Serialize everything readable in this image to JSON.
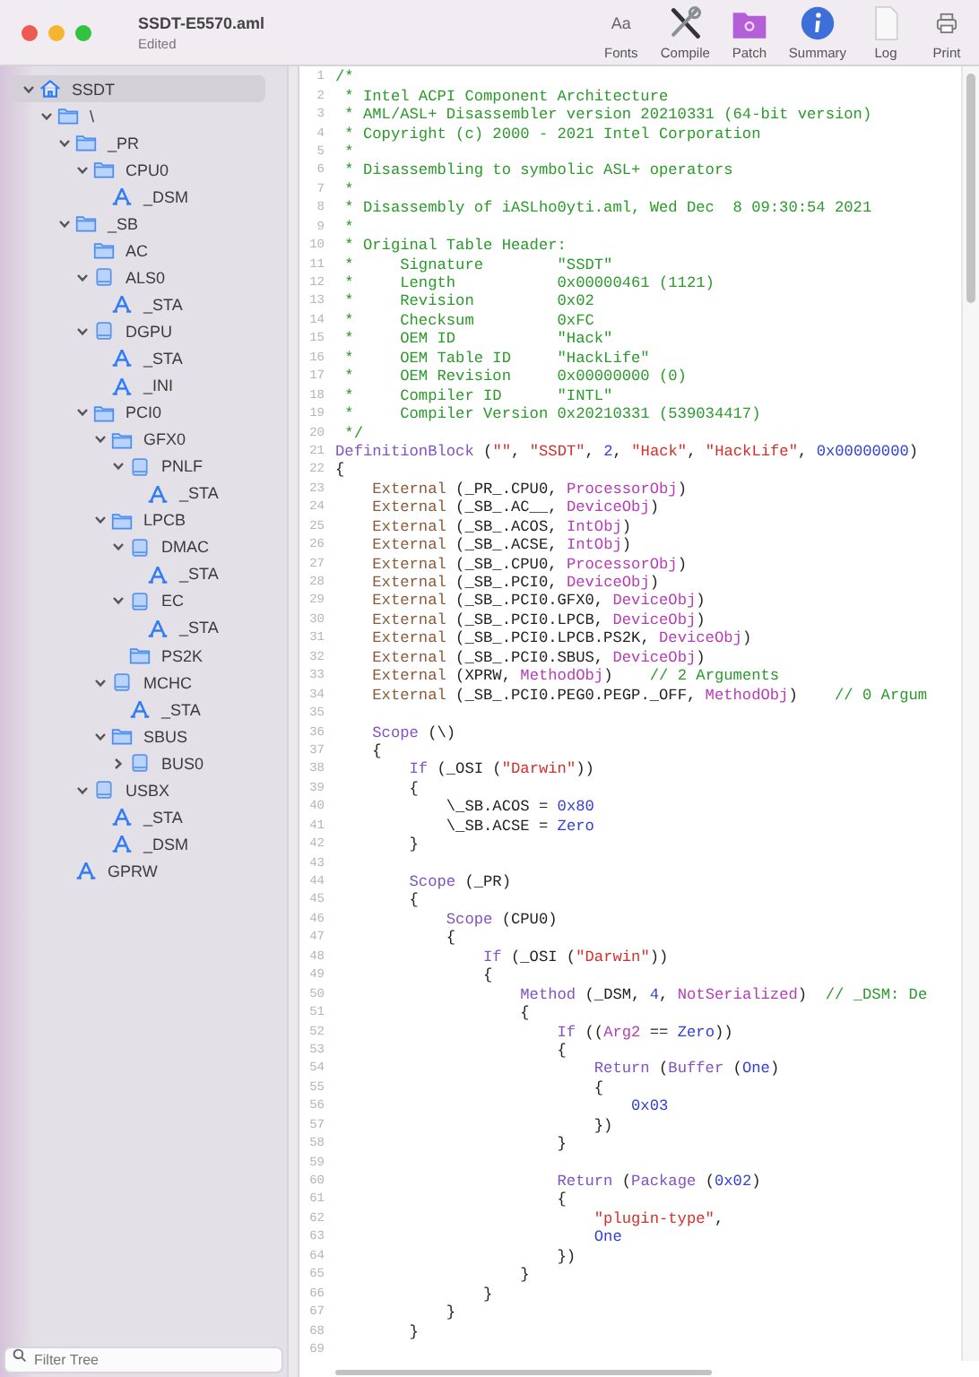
{
  "window": {
    "title": "SSDT-E5570.aml",
    "subtitle": "Edited"
  },
  "toolbar": [
    {
      "label": "Fonts",
      "kind": "fonts",
      "glyph": "Aa"
    },
    {
      "label": "Compile",
      "kind": "compile"
    },
    {
      "label": "Patch",
      "kind": "patch"
    },
    {
      "label": "Summary",
      "kind": "summary"
    },
    {
      "label": "Log",
      "kind": "log"
    },
    {
      "label": "Print",
      "kind": "print"
    }
  ],
  "sidebar": {
    "tree": [
      {
        "label": "SSDT",
        "kind": "root",
        "expanded": true,
        "selected": true,
        "children": [
          {
            "label": "\\",
            "kind": "folder",
            "expanded": true,
            "selected": false,
            "children": [
              {
                "label": "_PR",
                "kind": "folder",
                "expanded": true,
                "selected": false,
                "children": [
                  {
                    "label": "CPU0",
                    "kind": "folder",
                    "expanded": true,
                    "selected": false,
                    "children": [
                      {
                        "label": "_DSM",
                        "kind": "method",
                        "selected": false
                      }
                    ]
                  }
                ]
              },
              {
                "label": "_SB",
                "kind": "folder",
                "expanded": true,
                "selected": false,
                "children": [
                  {
                    "label": "AC",
                    "kind": "folder",
                    "selected": false
                  },
                  {
                    "label": "ALS0",
                    "kind": "device",
                    "expanded": true,
                    "selected": false,
                    "children": [
                      {
                        "label": "_STA",
                        "kind": "method",
                        "selected": false
                      }
                    ]
                  },
                  {
                    "label": "DGPU",
                    "kind": "device",
                    "expanded": true,
                    "selected": false,
                    "children": [
                      {
                        "label": "_STA",
                        "kind": "method",
                        "selected": false
                      },
                      {
                        "label": "_INI",
                        "kind": "method",
                        "selected": false
                      }
                    ]
                  },
                  {
                    "label": "PCI0",
                    "kind": "folder",
                    "expanded": true,
                    "selected": false,
                    "children": [
                      {
                        "label": "GFX0",
                        "kind": "folder",
                        "expanded": true,
                        "selected": false,
                        "children": [
                          {
                            "label": "PNLF",
                            "kind": "device",
                            "expanded": true,
                            "selected": false,
                            "children": [
                              {
                                "label": "_STA",
                                "kind": "method",
                                "selected": false
                              }
                            ]
                          }
                        ]
                      },
                      {
                        "label": "LPCB",
                        "kind": "folder",
                        "expanded": true,
                        "selected": false,
                        "children": [
                          {
                            "label": "DMAC",
                            "kind": "device",
                            "expanded": true,
                            "selected": false,
                            "children": [
                              {
                                "label": "_STA",
                                "kind": "method",
                                "selected": false
                              }
                            ]
                          },
                          {
                            "label": "EC",
                            "kind": "device",
                            "expanded": true,
                            "selected": false,
                            "children": [
                              {
                                "label": "_STA",
                                "kind": "method",
                                "selected": false
                              }
                            ]
                          },
                          {
                            "label": "PS2K",
                            "kind": "folder",
                            "selected": false
                          }
                        ]
                      },
                      {
                        "label": "MCHC",
                        "kind": "device",
                        "expanded": true,
                        "selected": false,
                        "children": [
                          {
                            "label": "_STA",
                            "kind": "method",
                            "selected": false
                          }
                        ]
                      },
                      {
                        "label": "SBUS",
                        "kind": "folder",
                        "expanded": true,
                        "selected": false,
                        "children": [
                          {
                            "label": "BUS0",
                            "kind": "device",
                            "expanded": false,
                            "selected": false
                          }
                        ]
                      }
                    ]
                  },
                  {
                    "label": "USBX",
                    "kind": "device",
                    "expanded": true,
                    "selected": false,
                    "children": [
                      {
                        "label": "_STA",
                        "kind": "method",
                        "selected": false
                      },
                      {
                        "label": "_DSM",
                        "kind": "method",
                        "selected": false
                      }
                    ]
                  }
                ]
              },
              {
                "label": "GPRW",
                "kind": "method",
                "selected": false
              }
            ]
          }
        ]
      }
    ],
    "filter": {
      "placeholder": "Filter Tree"
    }
  },
  "editor": {
    "lines": [
      {
        "number": "1",
        "tokens": [
          {
            "kind": "comment",
            "text": "/*"
          }
        ]
      },
      {
        "number": "2",
        "tokens": [
          {
            "kind": "comment",
            "text": " * Intel ACPI Component Architecture"
          }
        ]
      },
      {
        "number": "3",
        "tokens": [
          {
            "kind": "comment",
            "text": " * AML/ASL+ Disassembler version 20210331 (64-bit version)"
          }
        ]
      },
      {
        "number": "4",
        "tokens": [
          {
            "kind": "comment",
            "text": " * Copyright (c) 2000 - 2021 Intel Corporation"
          }
        ]
      },
      {
        "number": "5",
        "tokens": [
          {
            "kind": "comment",
            "text": " *"
          }
        ]
      },
      {
        "number": "6",
        "tokens": [
          {
            "kind": "comment",
            "text": " * Disassembling to symbolic ASL+ operators"
          }
        ]
      },
      {
        "number": "7",
        "tokens": [
          {
            "kind": "comment",
            "text": " *"
          }
        ]
      },
      {
        "number": "8",
        "tokens": [
          {
            "kind": "comment",
            "text": " * Disassembly of iASLho0yti.aml, Wed Dec  8 09:30:54 2021"
          }
        ]
      },
      {
        "number": "9",
        "tokens": [
          {
            "kind": "comment",
            "text": " *"
          }
        ]
      },
      {
        "number": "10",
        "tokens": [
          {
            "kind": "comment",
            "text": " * Original Table Header:"
          }
        ]
      },
      {
        "number": "11",
        "tokens": [
          {
            "kind": "comment",
            "text": " *     Signature        \"SSDT\""
          }
        ]
      },
      {
        "number": "12",
        "tokens": [
          {
            "kind": "comment",
            "text": " *     Length           0x00000461 (1121)"
          }
        ]
      },
      {
        "number": "13",
        "tokens": [
          {
            "kind": "comment",
            "text": " *     Revision         0x02"
          }
        ]
      },
      {
        "number": "14",
        "tokens": [
          {
            "kind": "comment",
            "text": " *     Checksum         0xFC"
          }
        ]
      },
      {
        "number": "15",
        "tokens": [
          {
            "kind": "comment",
            "text": " *     OEM ID           \"Hack\""
          }
        ]
      },
      {
        "number": "16",
        "tokens": [
          {
            "kind": "comment",
            "text": " *     OEM Table ID     \"HackLife\""
          }
        ]
      },
      {
        "number": "17",
        "tokens": [
          {
            "kind": "comment",
            "text": " *     OEM Revision     0x00000000 (0)"
          }
        ]
      },
      {
        "number": "18",
        "tokens": [
          {
            "kind": "comment",
            "text": " *     Compiler ID      \"INTL\""
          }
        ]
      },
      {
        "number": "19",
        "tokens": [
          {
            "kind": "comment",
            "text": " *     Compiler Version 0x20210331 (539034417)"
          }
        ]
      },
      {
        "number": "20",
        "tokens": [
          {
            "kind": "comment",
            "text": " */"
          }
        ]
      },
      {
        "number": "21",
        "tokens": [
          {
            "kind": "keyword",
            "text": "DefinitionBlock"
          },
          {
            "kind": "plain",
            "text": " ("
          },
          {
            "kind": "string",
            "text": "\"\""
          },
          {
            "kind": "plain",
            "text": ", "
          },
          {
            "kind": "string",
            "text": "\"SSDT\""
          },
          {
            "kind": "plain",
            "text": ", "
          },
          {
            "kind": "number",
            "text": "2"
          },
          {
            "kind": "plain",
            "text": ", "
          },
          {
            "kind": "string",
            "text": "\"Hack\""
          },
          {
            "kind": "plain",
            "text": ", "
          },
          {
            "kind": "string",
            "text": "\"HackLife\""
          },
          {
            "kind": "plain",
            "text": ", "
          },
          {
            "kind": "number",
            "text": "0x00000000"
          },
          {
            "kind": "plain",
            "text": ")"
          }
        ]
      },
      {
        "number": "22",
        "tokens": [
          {
            "kind": "plain",
            "text": "{"
          }
        ]
      },
      {
        "number": "23",
        "tokens": [
          {
            "kind": "external",
            "text": "    External"
          },
          {
            "kind": "plain",
            "text": " (_PR_.CPU0, "
          },
          {
            "kind": "type",
            "text": "ProcessorObj"
          },
          {
            "kind": "plain",
            "text": ")"
          }
        ]
      },
      {
        "number": "24",
        "tokens": [
          {
            "kind": "external",
            "text": "    External"
          },
          {
            "kind": "plain",
            "text": " (_SB_.AC__, "
          },
          {
            "kind": "type",
            "text": "DeviceObj"
          },
          {
            "kind": "plain",
            "text": ")"
          }
        ]
      },
      {
        "number": "25",
        "tokens": [
          {
            "kind": "external",
            "text": "    External"
          },
          {
            "kind": "plain",
            "text": " (_SB_.ACOS, "
          },
          {
            "kind": "type",
            "text": "IntObj"
          },
          {
            "kind": "plain",
            "text": ")"
          }
        ]
      },
      {
        "number": "26",
        "tokens": [
          {
            "kind": "external",
            "text": "    External"
          },
          {
            "kind": "plain",
            "text": " (_SB_.ACSE, "
          },
          {
            "kind": "type",
            "text": "IntObj"
          },
          {
            "kind": "plain",
            "text": ")"
          }
        ]
      },
      {
        "number": "27",
        "tokens": [
          {
            "kind": "external",
            "text": "    External"
          },
          {
            "kind": "plain",
            "text": " (_SB_.CPU0, "
          },
          {
            "kind": "type",
            "text": "ProcessorObj"
          },
          {
            "kind": "plain",
            "text": ")"
          }
        ]
      },
      {
        "number": "28",
        "tokens": [
          {
            "kind": "external",
            "text": "    External"
          },
          {
            "kind": "plain",
            "text": " (_SB_.PCI0, "
          },
          {
            "kind": "type",
            "text": "DeviceObj"
          },
          {
            "kind": "plain",
            "text": ")"
          }
        ]
      },
      {
        "number": "29",
        "tokens": [
          {
            "kind": "external",
            "text": "    External"
          },
          {
            "kind": "plain",
            "text": " (_SB_.PCI0.GFX0, "
          },
          {
            "kind": "type",
            "text": "DeviceObj"
          },
          {
            "kind": "plain",
            "text": ")"
          }
        ]
      },
      {
        "number": "30",
        "tokens": [
          {
            "kind": "external",
            "text": "    External"
          },
          {
            "kind": "plain",
            "text": " (_SB_.PCI0.LPCB, "
          },
          {
            "kind": "type",
            "text": "DeviceObj"
          },
          {
            "kind": "plain",
            "text": ")"
          }
        ]
      },
      {
        "number": "31",
        "tokens": [
          {
            "kind": "external",
            "text": "    External"
          },
          {
            "kind": "plain",
            "text": " (_SB_.PCI0.LPCB.PS2K, "
          },
          {
            "kind": "type",
            "text": "DeviceObj"
          },
          {
            "kind": "plain",
            "text": ")"
          }
        ]
      },
      {
        "number": "32",
        "tokens": [
          {
            "kind": "external",
            "text": "    External"
          },
          {
            "kind": "plain",
            "text": " (_SB_.PCI0.SBUS, "
          },
          {
            "kind": "type",
            "text": "DeviceObj"
          },
          {
            "kind": "plain",
            "text": ")"
          }
        ]
      },
      {
        "number": "33",
        "tokens": [
          {
            "kind": "external",
            "text": "    External"
          },
          {
            "kind": "plain",
            "text": " (XPRW, "
          },
          {
            "kind": "type",
            "text": "MethodObj"
          },
          {
            "kind": "plain",
            "text": ")"
          },
          {
            "kind": "comment",
            "text": "    // 2 Arguments"
          }
        ]
      },
      {
        "number": "34",
        "tokens": [
          {
            "kind": "external",
            "text": "    External"
          },
          {
            "kind": "plain",
            "text": " (_SB_.PCI0.PEG0.PEGP._OFF, "
          },
          {
            "kind": "type",
            "text": "MethodObj"
          },
          {
            "kind": "plain",
            "text": ")"
          },
          {
            "kind": "comment",
            "text": "    // 0 Argum"
          }
        ]
      },
      {
        "number": "35"
      },
      {
        "number": "36",
        "tokens": [
          {
            "kind": "keyword",
            "text": "    Scope"
          },
          {
            "kind": "plain",
            "text": " (\\)"
          }
        ]
      },
      {
        "number": "37",
        "tokens": [
          {
            "kind": "plain",
            "text": "    {"
          }
        ]
      },
      {
        "number": "38",
        "tokens": [
          {
            "kind": "keyword",
            "text": "        If"
          },
          {
            "kind": "plain",
            "text": " (_OSI ("
          },
          {
            "kind": "string",
            "text": "\"Darwin\""
          },
          {
            "kind": "plain",
            "text": "))"
          }
        ]
      },
      {
        "number": "39",
        "tokens": [
          {
            "kind": "plain",
            "text": "        {"
          }
        ]
      },
      {
        "number": "40",
        "tokens": [
          {
            "kind": "plain",
            "text": "            \\_SB.ACOS = "
          },
          {
            "kind": "number",
            "text": "0x80"
          }
        ]
      },
      {
        "number": "41",
        "tokens": [
          {
            "kind": "plain",
            "text": "            \\_SB.ACSE = "
          },
          {
            "kind": "number",
            "text": "Zero"
          }
        ]
      },
      {
        "number": "42",
        "tokens": [
          {
            "kind": "plain",
            "text": "        }"
          }
        ]
      },
      {
        "number": "43"
      },
      {
        "number": "44",
        "tokens": [
          {
            "kind": "keyword",
            "text": "        Scope"
          },
          {
            "kind": "plain",
            "text": " (_PR)"
          }
        ]
      },
      {
        "number": "45",
        "tokens": [
          {
            "kind": "plain",
            "text": "        {"
          }
        ]
      },
      {
        "number": "46",
        "tokens": [
          {
            "kind": "keyword",
            "text": "            Scope"
          },
          {
            "kind": "plain",
            "text": " (CPU0)"
          }
        ]
      },
      {
        "number": "47",
        "tokens": [
          {
            "kind": "plain",
            "text": "            {"
          }
        ]
      },
      {
        "number": "48",
        "tokens": [
          {
            "kind": "keyword",
            "text": "                If"
          },
          {
            "kind": "plain",
            "text": " (_OSI ("
          },
          {
            "kind": "string",
            "text": "\"Darwin\""
          },
          {
            "kind": "plain",
            "text": "))"
          }
        ]
      },
      {
        "number": "49",
        "tokens": [
          {
            "kind": "plain",
            "text": "                {"
          }
        ]
      },
      {
        "number": "50",
        "tokens": [
          {
            "kind": "keyword",
            "text": "                    Method"
          },
          {
            "kind": "plain",
            "text": " (_DSM, "
          },
          {
            "kind": "number",
            "text": "4"
          },
          {
            "kind": "plain",
            "text": ", "
          },
          {
            "kind": "type",
            "text": "NotSerialized"
          },
          {
            "kind": "plain",
            "text": ")  "
          },
          {
            "kind": "comment",
            "text": "// _DSM: De"
          }
        ]
      },
      {
        "number": "51",
        "tokens": [
          {
            "kind": "plain",
            "text": "                    {"
          }
        ]
      },
      {
        "number": "52",
        "tokens": [
          {
            "kind": "keyword",
            "text": "                        If"
          },
          {
            "kind": "plain",
            "text": " (("
          },
          {
            "kind": "type",
            "text": "Arg2"
          },
          {
            "kind": "plain",
            "text": " == "
          },
          {
            "kind": "number",
            "text": "Zero"
          },
          {
            "kind": "plain",
            "text": "))"
          }
        ]
      },
      {
        "number": "53",
        "tokens": [
          {
            "kind": "plain",
            "text": "                        {"
          }
        ]
      },
      {
        "number": "54",
        "tokens": [
          {
            "kind": "keyword",
            "text": "                            Return"
          },
          {
            "kind": "plain",
            "text": " ("
          },
          {
            "kind": "keyword",
            "text": "Buffer"
          },
          {
            "kind": "plain",
            "text": " ("
          },
          {
            "kind": "number",
            "text": "One"
          },
          {
            "kind": "plain",
            "text": ")"
          }
        ]
      },
      {
        "number": "55",
        "tokens": [
          {
            "kind": "plain",
            "text": "                            {"
          }
        ]
      },
      {
        "number": "56",
        "tokens": [
          {
            "kind": "number",
            "text": "                                0x03"
          }
        ]
      },
      {
        "number": "57",
        "tokens": [
          {
            "kind": "plain",
            "text": "                            })"
          }
        ]
      },
      {
        "number": "58",
        "tokens": [
          {
            "kind": "plain",
            "text": "                        }"
          }
        ]
      },
      {
        "number": "59"
      },
      {
        "number": "60",
        "tokens": [
          {
            "kind": "keyword",
            "text": "                        Return"
          },
          {
            "kind": "plain",
            "text": " ("
          },
          {
            "kind": "keyword",
            "text": "Package"
          },
          {
            "kind": "plain",
            "text": " ("
          },
          {
            "kind": "number",
            "text": "0x02"
          },
          {
            "kind": "plain",
            "text": ")"
          }
        ]
      },
      {
        "number": "61",
        "tokens": [
          {
            "kind": "plain",
            "text": "                        {"
          }
        ]
      },
      {
        "number": "62",
        "tokens": [
          {
            "kind": "string",
            "text": "                            \"plugin-type\""
          },
          {
            "kind": "plain",
            "text": ","
          }
        ]
      },
      {
        "number": "63",
        "tokens": [
          {
            "kind": "number",
            "text": "                            One"
          }
        ]
      },
      {
        "number": "64",
        "tokens": [
          {
            "kind": "plain",
            "text": "                        })"
          }
        ]
      },
      {
        "number": "65",
        "tokens": [
          {
            "kind": "plain",
            "text": "                    }"
          }
        ]
      },
      {
        "number": "66",
        "tokens": [
          {
            "kind": "plain",
            "text": "                }"
          }
        ]
      },
      {
        "number": "67",
        "tokens": [
          {
            "kind": "plain",
            "text": "            }"
          }
        ]
      },
      {
        "number": "68",
        "tokens": [
          {
            "kind": "plain",
            "text": "        }"
          }
        ]
      },
      {
        "number": "69"
      }
    ]
  }
}
